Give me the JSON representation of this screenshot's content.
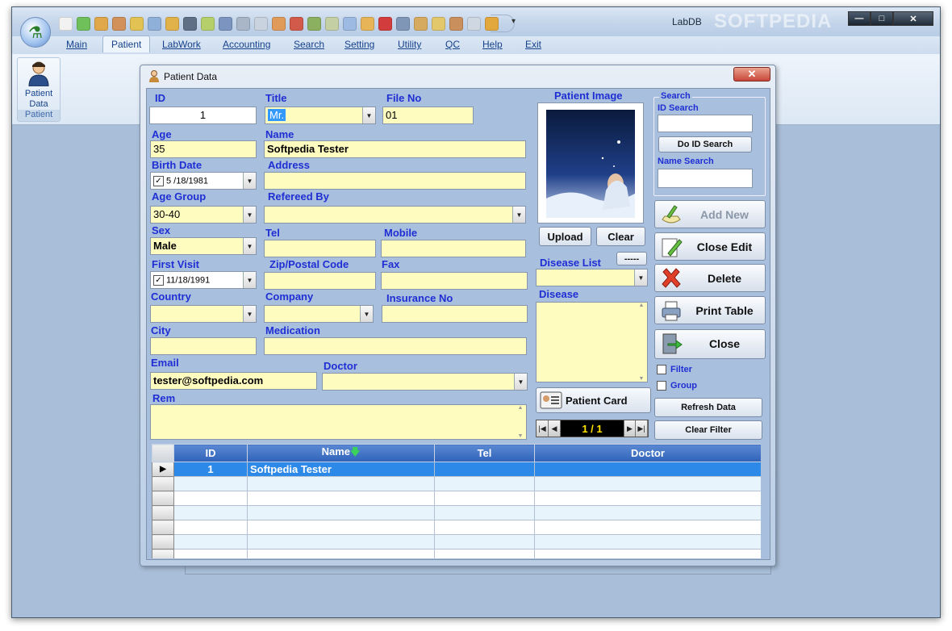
{
  "window": {
    "title": "LabDB",
    "watermark": "SOFTPEDIA",
    "controls": {
      "minimize": "—",
      "maximize": "□",
      "close": "✕"
    }
  },
  "qat_dropdown": "▾",
  "qat_icons": [
    "page-icon",
    "flask-icon",
    "people-icon",
    "person-icon",
    "chemicals-icon",
    "doc-icon",
    "folder-icon",
    "doctor-icon",
    "flask-icon",
    "microscope-icon",
    "settings-icon",
    "id-card-icon",
    "notepad-icon",
    "lab-icon",
    "truck-icon",
    "fork-icon",
    "report-icon",
    "email-icon",
    "cross-icon",
    "monitor-icon",
    "group-icon",
    "key-icon",
    "users-icon",
    "edit-icon",
    "chart-icon"
  ],
  "menu": [
    "Main",
    "Patient",
    "LabWork",
    "Accounting",
    "Search",
    "Setting",
    "Utility",
    "QC",
    "Help",
    "Exit"
  ],
  "menu_active": "Patient",
  "ribbon": {
    "button_label_1": "Patient",
    "button_label_2": "Data",
    "group_label": "Patient"
  },
  "dialog": {
    "title": "Patient Data",
    "close": "✕",
    "labels": {
      "id": "ID",
      "title": "Title",
      "file_no": "File No",
      "age": "Age",
      "name": "Name",
      "birth_date": "Birth Date",
      "address": "Address",
      "age_group": "Age Group",
      "refereed_by": "Refereed By",
      "sex": "Sex",
      "tel": "Tel",
      "mobile": "Mobile",
      "first_visit": "First Visit",
      "zip": "Zip/Postal Code",
      "fax": "Fax",
      "country": "Country",
      "company": "Company",
      "insurance_no": "Insurance No",
      "city": "City",
      "medication": "Medication",
      "email": "Email",
      "doctor": "Doctor",
      "rem": "Rem",
      "patient_image": "Patient Image",
      "disease_list": "Disease List",
      "disease": "Disease"
    },
    "values": {
      "id": "1",
      "title": "Mr.",
      "file_no": "01",
      "age": "35",
      "name": "Softpedia Tester",
      "birth_date": "5 /18/1981",
      "address": "",
      "age_group": "30-40",
      "refereed_by": "",
      "sex": "Male",
      "tel": "",
      "mobile": "",
      "first_visit": "11/18/1991",
      "zip": "",
      "fax": "",
      "country": "",
      "company": "",
      "insurance_no": "",
      "city": "",
      "medication": "",
      "email": "tester@softpedia.com",
      "doctor": "",
      "rem": "",
      "disease_list": "",
      "disease": ""
    },
    "check_mark": "✓",
    "buttons": {
      "upload": "Upload",
      "clear": "Clear",
      "disease_small": "-----",
      "patient_card": "Patient Card",
      "add_new": "Add New",
      "close_edit": "Close Edit",
      "delete": "Delete",
      "print_table": "Print Table",
      "close": "Close",
      "refresh_data": "Refresh Data",
      "clear_filter": "Clear Filter"
    },
    "search": {
      "legend": "Search",
      "id_search_label": "ID Search",
      "id_search_value": "",
      "do_id_search": "Do ID Search",
      "name_search_label": "Name Search",
      "name_search_value": ""
    },
    "filter_label": "Filter",
    "group_label": "Group",
    "navigator": {
      "count": "1 / 1",
      "first": "|◀",
      "prev": "◀",
      "next": "▶",
      "last": "▶|"
    }
  },
  "grid": {
    "columns": [
      "ID",
      "Name",
      "Tel",
      "Doctor"
    ],
    "sort_indicator": "🡇",
    "row_pointer": "▶",
    "rows": [
      {
        "id": "1",
        "name": "Softpedia Tester",
        "tel": "",
        "doctor": ""
      }
    ]
  },
  "colors": {
    "label_blue": "#1f2fd3",
    "field_yellow": "#fffcc0",
    "grid_header": "#2f62b8",
    "selected_row": "#2d89e8"
  }
}
